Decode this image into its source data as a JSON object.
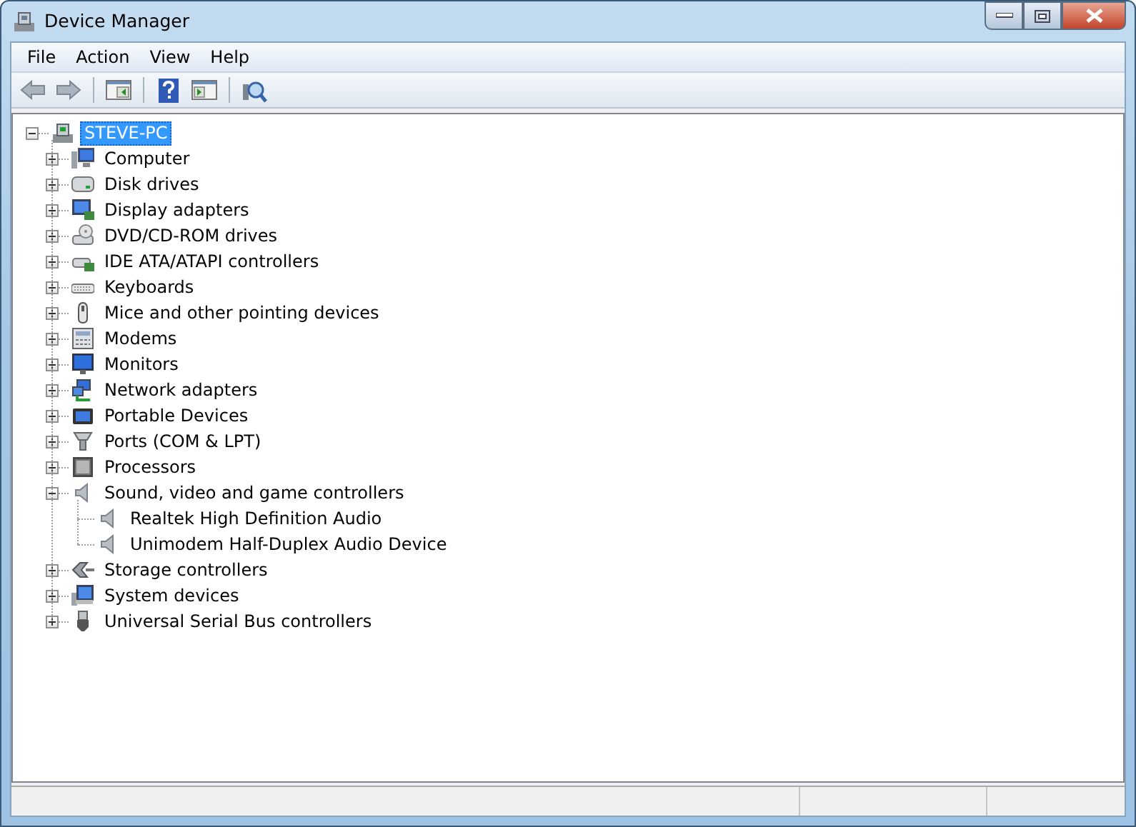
{
  "window": {
    "title": "Device Manager"
  },
  "menu": [
    {
      "label": "File"
    },
    {
      "label": "Action"
    },
    {
      "label": "View"
    },
    {
      "label": "Help"
    }
  ],
  "tree": {
    "label": "STEVE-PC",
    "expanded": true,
    "selected": true,
    "children": [
      {
        "label": "Computer",
        "expanded": false,
        "selected": false
      },
      {
        "label": "Disk drives",
        "expanded": false,
        "selected": false
      },
      {
        "label": "Display adapters",
        "expanded": false,
        "selected": false
      },
      {
        "label": "DVD/CD-ROM drives",
        "expanded": false,
        "selected": false
      },
      {
        "label": "IDE ATA/ATAPI controllers",
        "expanded": false,
        "selected": false
      },
      {
        "label": "Keyboards",
        "expanded": false,
        "selected": false
      },
      {
        "label": "Mice and other pointing devices",
        "expanded": false,
        "selected": false
      },
      {
        "label": "Modems",
        "expanded": false,
        "selected": false
      },
      {
        "label": "Monitors",
        "expanded": false,
        "selected": false
      },
      {
        "label": "Network adapters",
        "expanded": false,
        "selected": false
      },
      {
        "label": "Portable Devices",
        "expanded": false,
        "selected": false
      },
      {
        "label": "Ports (COM & LPT)",
        "expanded": false,
        "selected": false
      },
      {
        "label": "Processors",
        "expanded": false,
        "selected": false
      },
      {
        "label": "Sound, video and game controllers",
        "expanded": true,
        "selected": false,
        "children": [
          {
            "label": "Realtek High Definition Audio",
            "selected": false
          },
          {
            "label": "Unimodem Half-Duplex Audio Device",
            "selected": false
          }
        ]
      },
      {
        "label": "Storage controllers",
        "expanded": false,
        "selected": false
      },
      {
        "label": "System devices",
        "expanded": false,
        "selected": false
      },
      {
        "label": "Universal Serial Bus controllers",
        "expanded": false,
        "selected": false
      }
    ]
  }
}
